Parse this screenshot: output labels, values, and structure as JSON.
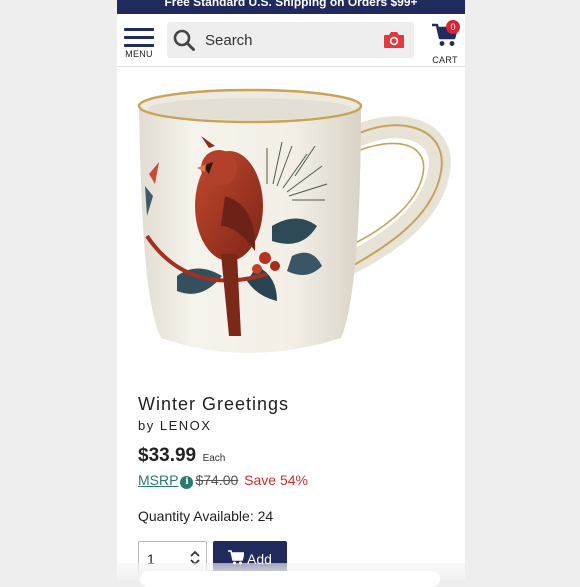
{
  "promo_banner": {
    "text": "Free Standard U.S. Shipping on Orders $99+"
  },
  "header": {
    "menu_label": "MENU",
    "search_placeholder": "Search",
    "cart_label": "CART",
    "cart_count": "0"
  },
  "colors": {
    "brand_navy": "#202a5c",
    "msrp_teal": "#2a7a6d",
    "sale_red": "#c0312d",
    "badge_red": "#d9252f",
    "camera_red": "#e0393e"
  },
  "product": {
    "image_icon": "cardinal-mug-image",
    "title": "Winter Greetings",
    "brand": "by LENOX",
    "price": "$33.99",
    "price_unit": "Each",
    "msrp_label": "MSRP",
    "msrp_price": "$74.00",
    "savings": "Save 54%",
    "quantity_available": "Quantity Available: 24"
  },
  "purchase": {
    "quantity_value": "1",
    "add_label": "Add"
  }
}
